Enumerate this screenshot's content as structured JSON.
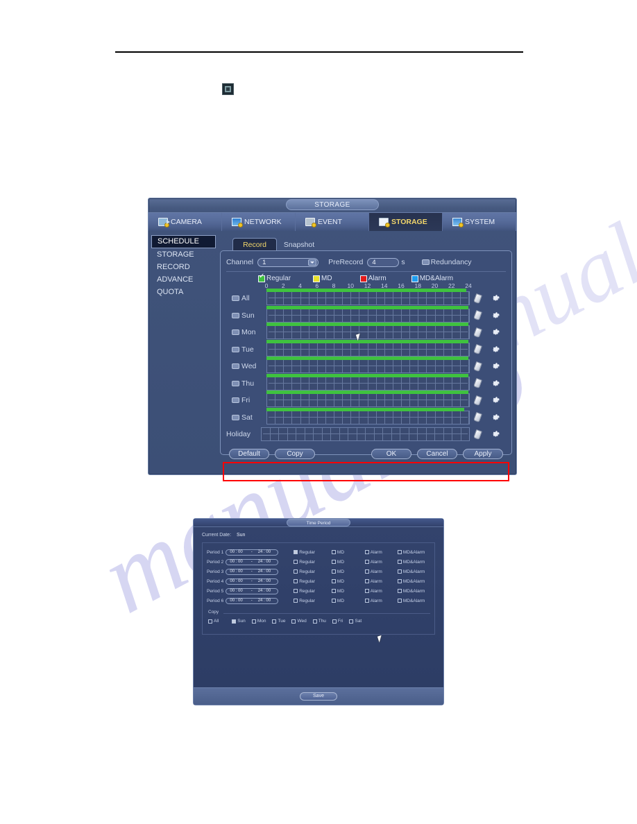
{
  "page": {
    "decor_icon": "screenshot-thumbnail-icon"
  },
  "watermark": {
    "text": "manualslib"
  },
  "storage_window": {
    "title": "STORAGE",
    "menu_tabs": [
      {
        "label": "CAMERA",
        "icon": "camera-icon",
        "active": false
      },
      {
        "label": "NETWORK",
        "icon": "network-icon",
        "active": false
      },
      {
        "label": "EVENT",
        "icon": "event-icon",
        "active": false
      },
      {
        "label": "STORAGE",
        "icon": "storage-icon",
        "active": true
      },
      {
        "label": "SYSTEM",
        "icon": "system-icon",
        "active": false
      }
    ],
    "sidebar": [
      {
        "label": "SCHEDULE",
        "active": true
      },
      {
        "label": "STORAGE",
        "active": false
      },
      {
        "label": "RECORD",
        "active": false
      },
      {
        "label": "ADVANCE",
        "active": false
      },
      {
        "label": "QUOTA",
        "active": false
      }
    ],
    "tabs": [
      {
        "label": "Record",
        "active": true
      },
      {
        "label": "Snapshot",
        "active": false
      }
    ],
    "form": {
      "channel_label": "Channel",
      "channel_value": "1",
      "prerecord_label": "PreRecord",
      "prerecord_value": "4",
      "prerecord_unit": "s",
      "redundancy_label": "Redundancy",
      "redundancy_checked": false
    },
    "legend": [
      {
        "label": "Regular",
        "color": "#3fc23f",
        "checked": true
      },
      {
        "label": "MD",
        "color": "#e8e02a",
        "checked": false
      },
      {
        "label": "Alarm",
        "color": "#e21b1b",
        "checked": false
      },
      {
        "label": "MD&Alarm",
        "color": "#1f9ef0",
        "checked": false
      }
    ],
    "ruler_ticks": [
      "0",
      "2",
      "4",
      "6",
      "8",
      "10",
      "12",
      "14",
      "16",
      "18",
      "20",
      "22",
      "24"
    ],
    "schedule_rows": [
      {
        "label": "All",
        "checkbox": true,
        "green": true
      },
      {
        "label": "Sun",
        "checkbox": true,
        "green": true
      },
      {
        "label": "Mon",
        "checkbox": true,
        "green": true
      },
      {
        "label": "Tue",
        "checkbox": true,
        "green": true
      },
      {
        "label": "Wed",
        "checkbox": true,
        "green": true
      },
      {
        "label": "Thu",
        "checkbox": true,
        "green": true
      },
      {
        "label": "Fri",
        "checkbox": true,
        "green": true
      },
      {
        "label": "Sat",
        "checkbox": true,
        "green": true
      },
      {
        "label": "Holiday",
        "checkbox": false,
        "green": false
      }
    ],
    "highlight_color": "#ff0000",
    "buttons": {
      "default": "Default",
      "copy": "Copy",
      "ok": "OK",
      "cancel": "Cancel",
      "apply": "Apply"
    }
  },
  "timeperiod_window": {
    "title": "Time Period",
    "current_date_label": "Current Date:",
    "current_date_value": "Sun",
    "time_start": "00 : 00",
    "time_dash": "-",
    "time_end": "24 : 00",
    "periods": [
      {
        "label": "Period 1",
        "regular": true,
        "md": false,
        "alarm": false,
        "md_alarm": false
      },
      {
        "label": "Period 2",
        "regular": false,
        "md": false,
        "alarm": false,
        "md_alarm": false
      },
      {
        "label": "Period 3",
        "regular": false,
        "md": false,
        "alarm": false,
        "md_alarm": false
      },
      {
        "label": "Period 4",
        "regular": false,
        "md": false,
        "alarm": false,
        "md_alarm": false
      },
      {
        "label": "Period 5",
        "regular": false,
        "md": false,
        "alarm": false,
        "md_alarm": false
      },
      {
        "label": "Period 6",
        "regular": false,
        "md": false,
        "alarm": false,
        "md_alarm": false
      }
    ],
    "mode_labels": {
      "regular": "Regular",
      "md": "MD",
      "alarm": "Alarm",
      "md_alarm": "MD&Alarm"
    },
    "copy_label": "Copy",
    "copy_days": [
      {
        "label": "All",
        "checked": false
      },
      {
        "label": "Sun",
        "checked": true
      },
      {
        "label": "Mon",
        "checked": false
      },
      {
        "label": "Tue",
        "checked": false
      },
      {
        "label": "Wed",
        "checked": false
      },
      {
        "label": "Thu",
        "checked": false
      },
      {
        "label": "Fri",
        "checked": false
      },
      {
        "label": "Sat",
        "checked": false
      }
    ],
    "save_label": "Save"
  }
}
